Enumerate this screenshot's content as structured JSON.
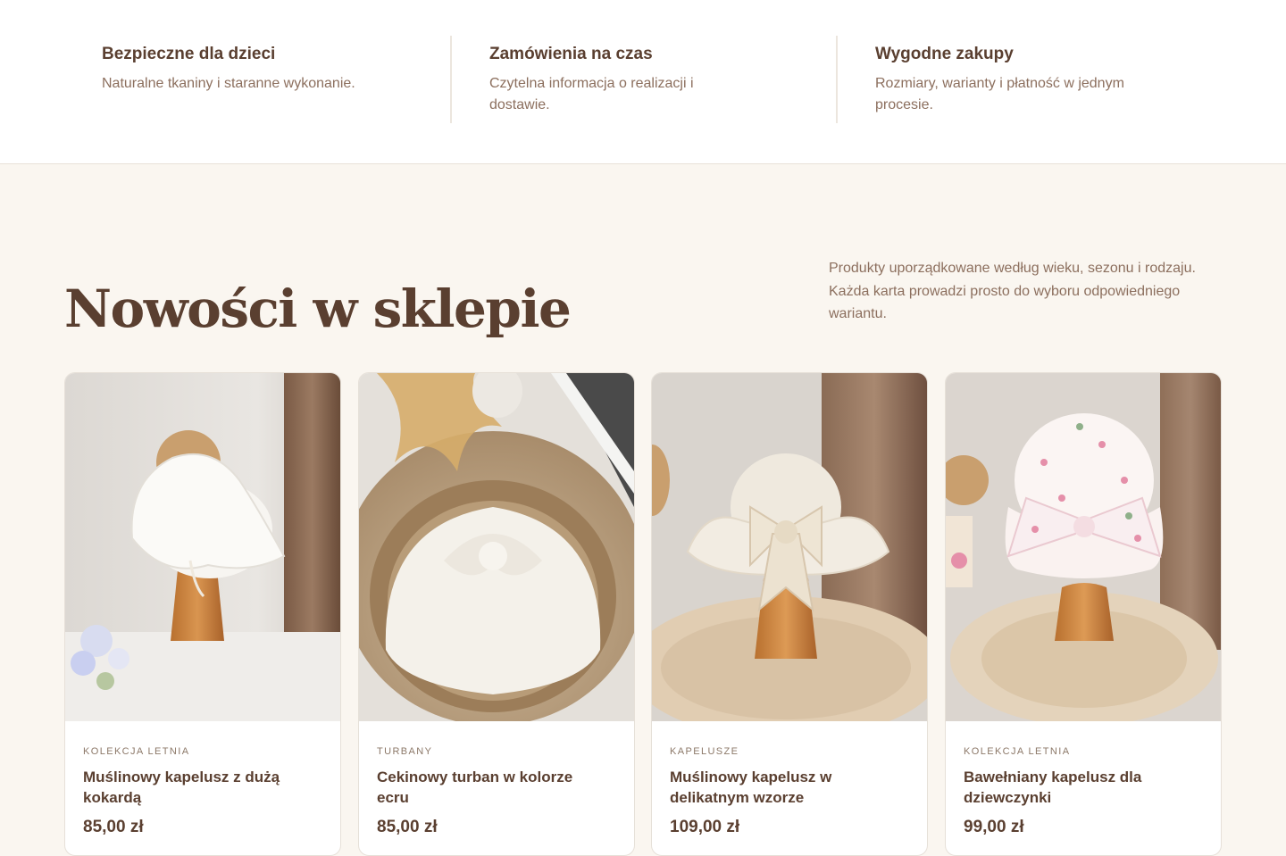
{
  "features": [
    {
      "title": "Bezpieczne dla dzieci",
      "text": "Naturalne tkaniny i staranne wykonanie."
    },
    {
      "title": "Zamówienia na czas",
      "text": "Czytelna informacja o realizacji i dostawie."
    },
    {
      "title": "Wygodne zakupy",
      "text": "Rozmiary, warianty i płatność w jednym procesie."
    }
  ],
  "section": {
    "title": "Nowości w sklepie",
    "intro": "Produkty uporządkowane według wieku, sezonu i rodzaju. Każda karta prowadzi prosto do wyboru odpowiedniego wariantu."
  },
  "products": [
    {
      "category": "KOLEKCJA LETNIA",
      "name": "Muślinowy kapelusz z dużą kokardą",
      "price": "85,00 zł",
      "image": "white-sun-hat-on-wooden-stand"
    },
    {
      "category": "TURBANY",
      "name": "Cekinowy turban w kolorze ecru",
      "price": "85,00 zł",
      "image": "ecru-turban-in-wicker-basket"
    },
    {
      "category": "KAPELUSZE",
      "name": "Muślinowy kapelusz w delikatnym wzorze",
      "price": "109,00 zł",
      "image": "patterned-hat-with-bow"
    },
    {
      "category": "KOLEKCJA LETNIA",
      "name": "Bawełniany kapelusz dla dziewczynki",
      "price": "99,00 zł",
      "image": "floral-hat-with-bow"
    }
  ]
}
